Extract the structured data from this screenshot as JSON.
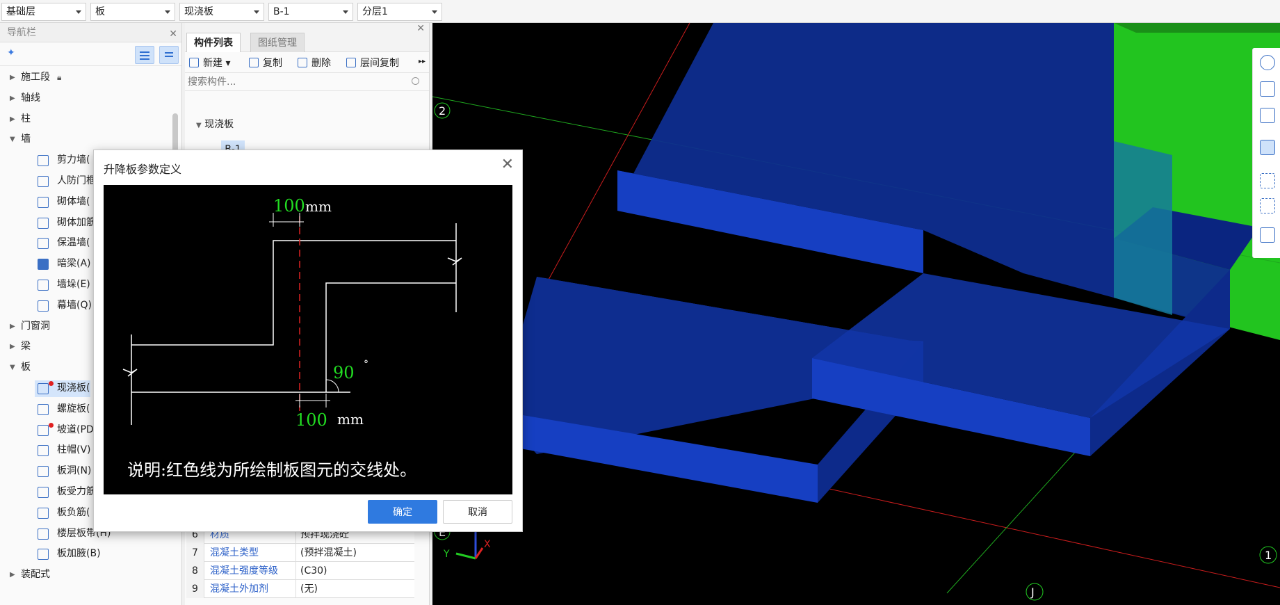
{
  "toolbar": {
    "selects": [
      "基础层",
      "板",
      "现浇板",
      "B-1",
      "分层1"
    ]
  },
  "nav": {
    "title": "导航栏",
    "tree": [
      {
        "label": "施工段",
        "level": 1,
        "expanded": false,
        "locked": true
      },
      {
        "label": "轴线",
        "level": 1,
        "expanded": false
      },
      {
        "label": "柱",
        "level": 1,
        "expanded": false
      },
      {
        "label": "墙",
        "level": 1,
        "expanded": true
      },
      {
        "label": "剪力墙(",
        "level": 2,
        "icon": "shear-wall-icon"
      },
      {
        "label": "人防门框",
        "level": 2,
        "icon": "civil-door-frame-icon"
      },
      {
        "label": "砌体墙(",
        "level": 2,
        "icon": "masonry-wall-icon"
      },
      {
        "label": "砌体加筋",
        "level": 2,
        "icon": "masonry-rebar-icon"
      },
      {
        "label": "保温墙(",
        "level": 2,
        "icon": "insulation-wall-icon"
      },
      {
        "label": "暗梁(A)",
        "level": 2,
        "icon": "hidden-beam-icon"
      },
      {
        "label": "墙垛(E)",
        "level": 2,
        "icon": "wall-pier-icon"
      },
      {
        "label": "幕墙(Q)",
        "level": 2,
        "icon": "curtain-wall-icon"
      },
      {
        "label": "门窗洞",
        "level": 1,
        "expanded": false
      },
      {
        "label": "梁",
        "level": 1,
        "expanded": false
      },
      {
        "label": "板",
        "level": 1,
        "expanded": true
      },
      {
        "label": "现浇板(",
        "level": 2,
        "icon": "cast-slab-icon",
        "selected": true,
        "dot": true
      },
      {
        "label": "螺旋板(",
        "level": 2,
        "icon": "spiral-slab-icon"
      },
      {
        "label": "坡道(PD",
        "level": 2,
        "icon": "ramp-icon",
        "dot": true
      },
      {
        "label": "柱帽(V)",
        "level": 2,
        "icon": "column-cap-icon"
      },
      {
        "label": "板洞(N)",
        "level": 2,
        "icon": "slab-hole-icon"
      },
      {
        "label": "板受力筋",
        "level": 2,
        "icon": "slab-rebar-icon"
      },
      {
        "label": "板负筋(",
        "level": 2,
        "icon": "slab-neg-rebar-icon"
      },
      {
        "label": "楼层板带(H)",
        "level": 2,
        "icon": "floor-strip-icon"
      },
      {
        "label": "板加腋(B)",
        "level": 2,
        "icon": "slab-haunch-icon"
      },
      {
        "label": "装配式",
        "level": 1,
        "expanded": false
      }
    ]
  },
  "component": {
    "tab_active": "构件列表",
    "tab_inactive": "图纸管理",
    "new_label": "新建",
    "copy_label": "复制",
    "delete_label": "删除",
    "floor_copy_label": "层间复制",
    "search_placeholder": "搜索构件...",
    "tree_root": "现浇板",
    "tree_child": "B-1"
  },
  "properties": [
    {
      "num": "6",
      "name": "材质",
      "value": "预拌现浇砼"
    },
    {
      "num": "7",
      "name": "混凝土类型",
      "value": "(预拌混凝土)"
    },
    {
      "num": "8",
      "name": "混凝土强度等级",
      "value": "(C30)"
    },
    {
      "num": "9",
      "name": "混凝土外加剂",
      "value": "(无)"
    }
  ],
  "view": {
    "grid_labels": [
      "2",
      "1",
      "J",
      "E"
    ],
    "axis_x": "X",
    "axis_y": "Y"
  },
  "dialog": {
    "title": "升降板参数定义",
    "top_value": "100",
    "top_unit": "mm",
    "angle_value": "90",
    "angle_unit": "°",
    "bottom_value": "100",
    "bottom_unit": "mm",
    "note": "说明:红色线为所绘制板图元的交线处。",
    "ok_label": "确定",
    "cancel_label": "取消"
  },
  "colors": {
    "accent": "#2f7ae0",
    "slab_blue": "#1a3fa8",
    "wall_green": "#22c41f",
    "label_green": "#22dd22"
  }
}
